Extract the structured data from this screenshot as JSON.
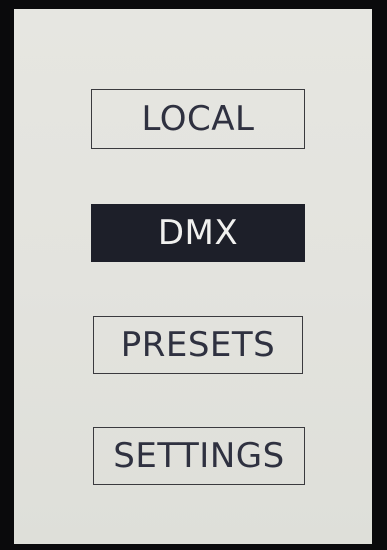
{
  "menu": {
    "items": [
      {
        "label": "LOCAL",
        "selected": false
      },
      {
        "label": "DMX",
        "selected": true
      },
      {
        "label": "PRESETS",
        "selected": false
      },
      {
        "label": "SETTINGS",
        "selected": false
      }
    ]
  },
  "colors": {
    "screen_background": "#e4e4df",
    "text": "#2f3140",
    "selected_background": "#1d1f29",
    "selected_text": "#f1f1ef",
    "bezel": "#0a0a0c"
  }
}
